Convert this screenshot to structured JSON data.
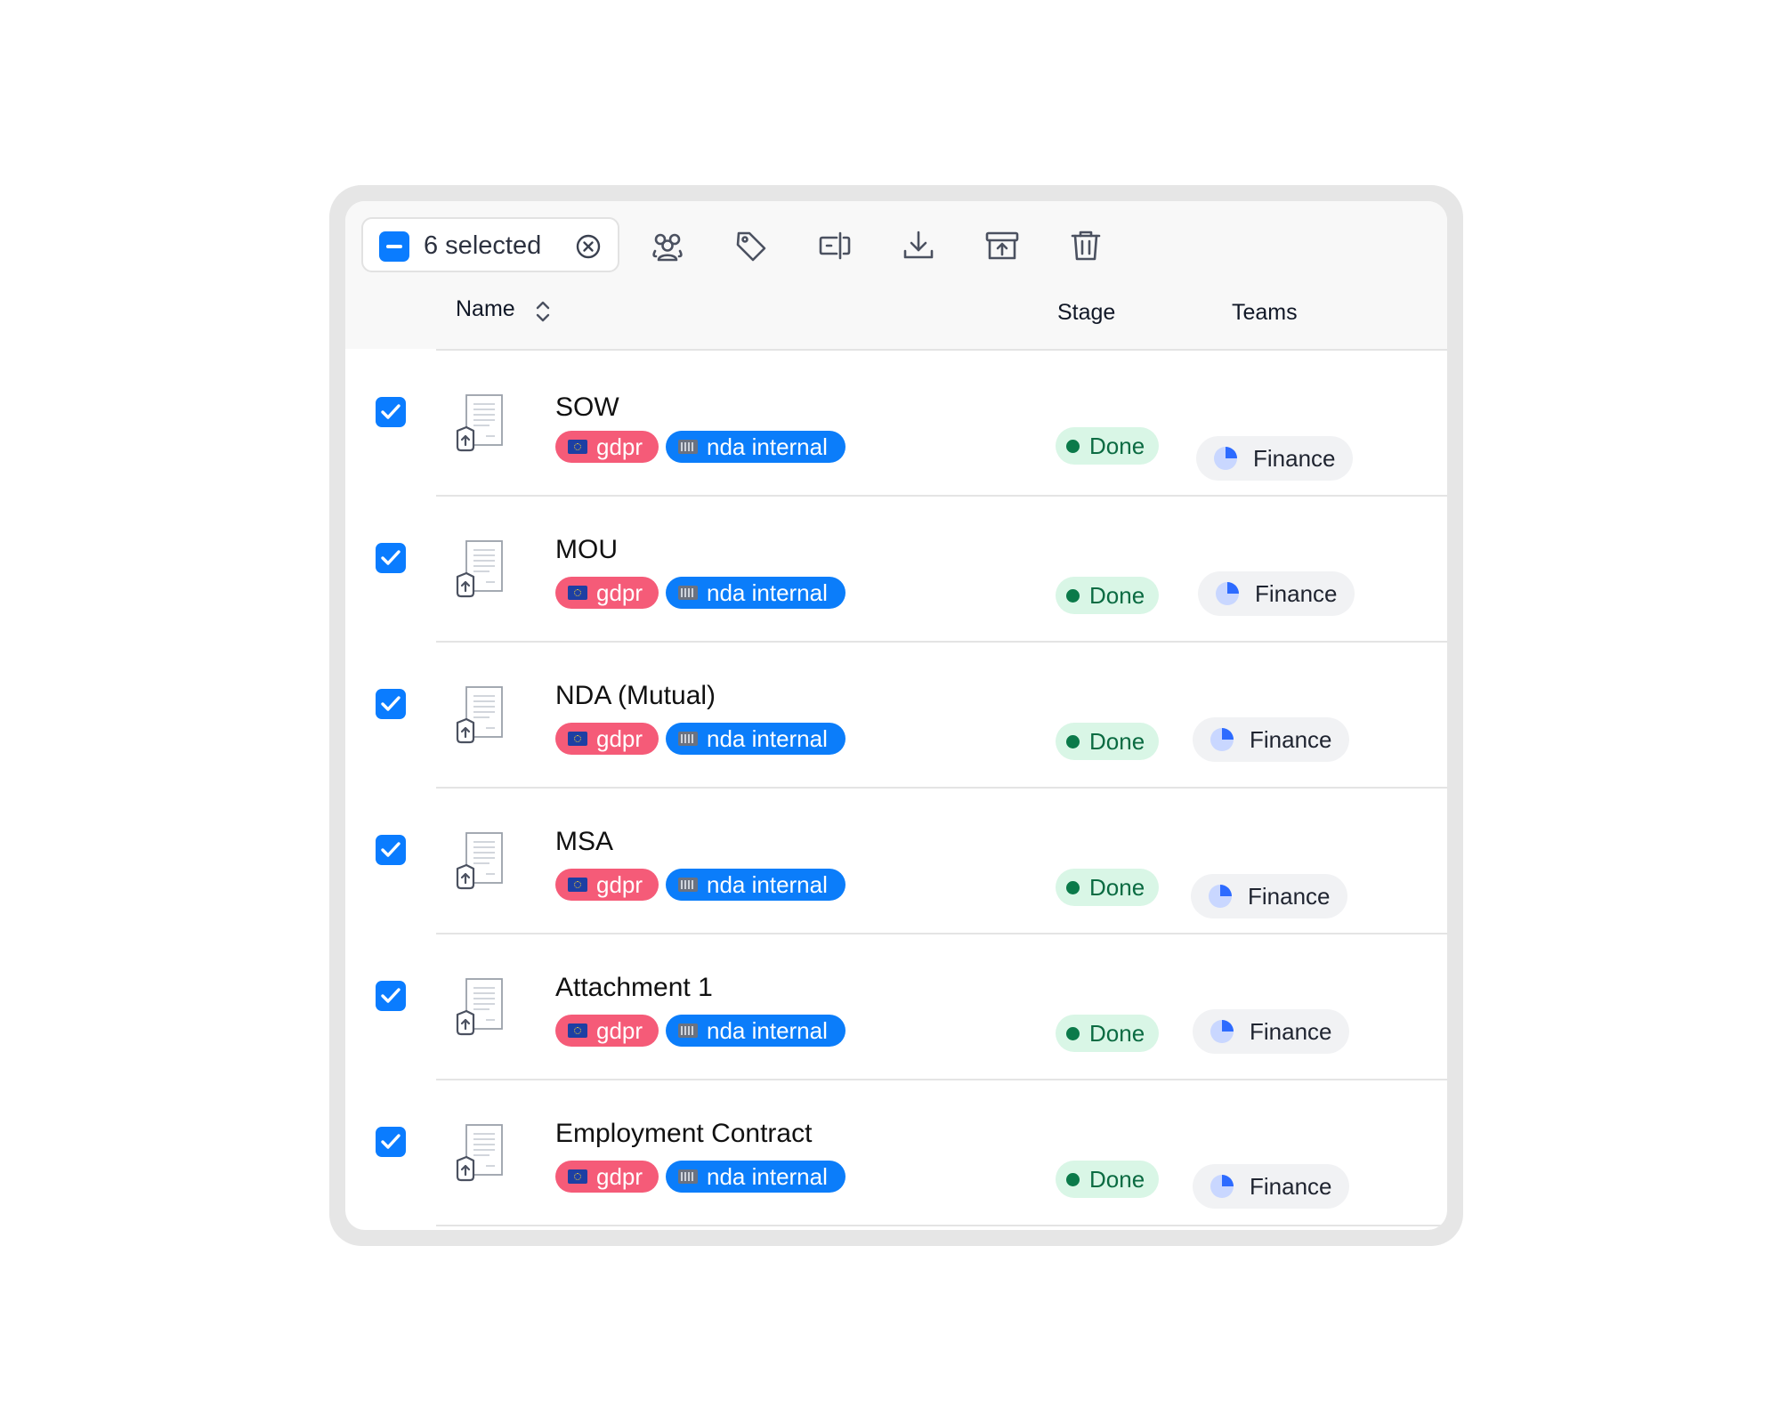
{
  "toolbar": {
    "selected_label": "6 selected",
    "icons": [
      "people-icon",
      "tag-icon",
      "rename-icon",
      "download-icon",
      "archive-icon",
      "trash-icon"
    ]
  },
  "columns": {
    "name": "Name",
    "stage": "Stage",
    "teams": "Teams"
  },
  "rows": [
    {
      "name": "SOW",
      "checked": true,
      "tags": [
        "gdpr",
        "nda internal"
      ],
      "stage": "Done",
      "team": "Finance"
    },
    {
      "name": "MOU",
      "checked": true,
      "tags": [
        "gdpr",
        "nda internal"
      ],
      "stage": "Done",
      "team": "Finance"
    },
    {
      "name": "NDA (Mutual)",
      "checked": true,
      "tags": [
        "gdpr",
        "nda internal"
      ],
      "stage": "Done",
      "team": "Finance"
    },
    {
      "name": "MSA",
      "checked": true,
      "tags": [
        "gdpr",
        "nda internal"
      ],
      "stage": "Done",
      "team": "Finance"
    },
    {
      "name": "Attachment 1",
      "checked": true,
      "tags": [
        "gdpr",
        "nda internal"
      ],
      "stage": "Done",
      "team": "Finance"
    },
    {
      "name": "Employment Contract",
      "checked": true,
      "tags": [
        "gdpr",
        "nda internal"
      ],
      "stage": "Done",
      "team": "Finance"
    }
  ],
  "colors": {
    "accent": "#0a7cff",
    "gdpr_tag": "#f55b78",
    "nda_tag": "#0b7dfa",
    "stage_done_bg": "#d9f6e6",
    "stage_done_text": "#0b6b42"
  }
}
